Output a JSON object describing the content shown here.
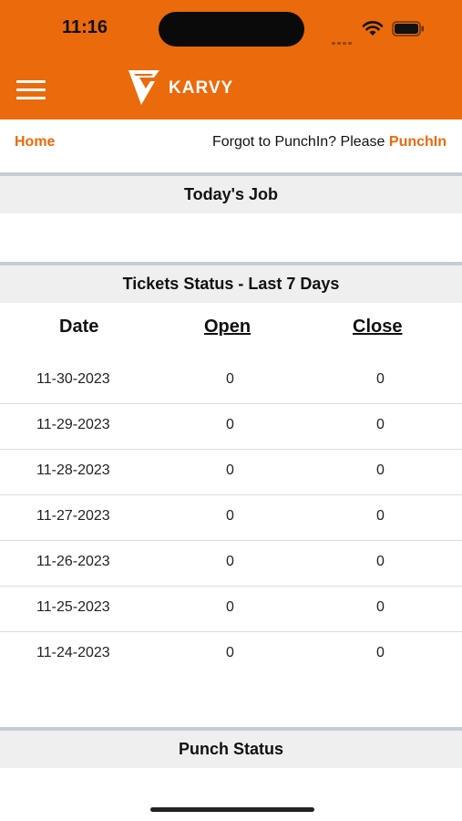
{
  "status_bar": {
    "time": "11:16"
  },
  "header": {
    "brand": "KARVY",
    "menu_icon": "hamburger-menu-icon",
    "accent": "#ea6a0c"
  },
  "subnav": {
    "home": "Home",
    "forgot_prefix": "Forgot to PunchIn? Please ",
    "punchin_link": "PunchIn"
  },
  "todays_job": {
    "title": "Today's Job"
  },
  "tickets": {
    "title": "Tickets Status - Last 7 Days",
    "columns": [
      "Date",
      "Open",
      "Close"
    ],
    "rows": [
      {
        "date": "11-30-2023",
        "open": "0",
        "close": "0"
      },
      {
        "date": "11-29-2023",
        "open": "0",
        "close": "0"
      },
      {
        "date": "11-28-2023",
        "open": "0",
        "close": "0"
      },
      {
        "date": "11-27-2023",
        "open": "0",
        "close": "0"
      },
      {
        "date": "11-26-2023",
        "open": "0",
        "close": "0"
      },
      {
        "date": "11-25-2023",
        "open": "0",
        "close": "0"
      },
      {
        "date": "11-24-2023",
        "open": "0",
        "close": "0"
      }
    ]
  },
  "punch_status": {
    "title": "Punch Status"
  }
}
